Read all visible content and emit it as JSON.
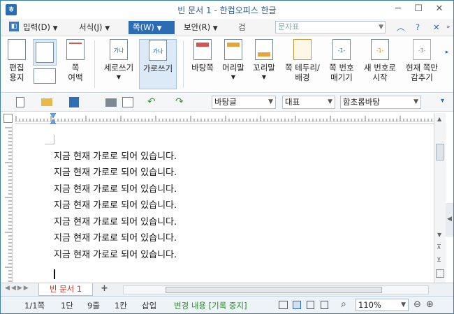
{
  "window": {
    "title": "빈 문서 1 - 한컴오피스 한글"
  },
  "menu": {
    "items": [
      {
        "label": "입력(D)"
      },
      {
        "label": "서식(J)"
      },
      {
        "label": "쪽(W)"
      },
      {
        "label": "보안(R)"
      }
    ],
    "search_placeholder": "문자표"
  },
  "ribbon": {
    "edit_paper": "편집\n용지",
    "page_margin": "쪽\n여백",
    "portrait": "세로쓰기",
    "landscape": "가로쓰기",
    "background_page": "바탕쪽",
    "header": "머리말",
    "footer": "꼬리말",
    "page_border": "쪽 테두리/\n배경",
    "page_number": "쪽 번호\n매기기",
    "new_number": "새 번호로\n시작",
    "hide_current": "현재 쪽만\n감추기"
  },
  "toolbar": {
    "style": "바탕글",
    "font_lang": "대표",
    "font": "함초롬바탕"
  },
  "document": {
    "lines": [
      "지금 현재 가로로 되어 있습니다.",
      "지금 현재 가로로 되어 있습니다.",
      "지금 현재 가로로 되어 있습니다.",
      "지금 현재 가로로 되어 있습니다.",
      "지금 현재 가로로 되어 있습니다.",
      "지금 현재 가로로 되어 있습니다.",
      "지금 현재 가로로 되어 있습니다."
    ]
  },
  "tabs": {
    "doc_tab": "빈 문서 1",
    "add_tab": "+"
  },
  "status": {
    "page": "1/1쪽",
    "section": "1단",
    "line": "9줄",
    "column": "1칸",
    "insert": "삽입",
    "track": "변경 내용 [기록 중지]",
    "zoom": "110%"
  },
  "colors": {
    "accent": "#2b6cb5",
    "tab_text": "#c0392b",
    "status_green": "#2f8a2f"
  }
}
